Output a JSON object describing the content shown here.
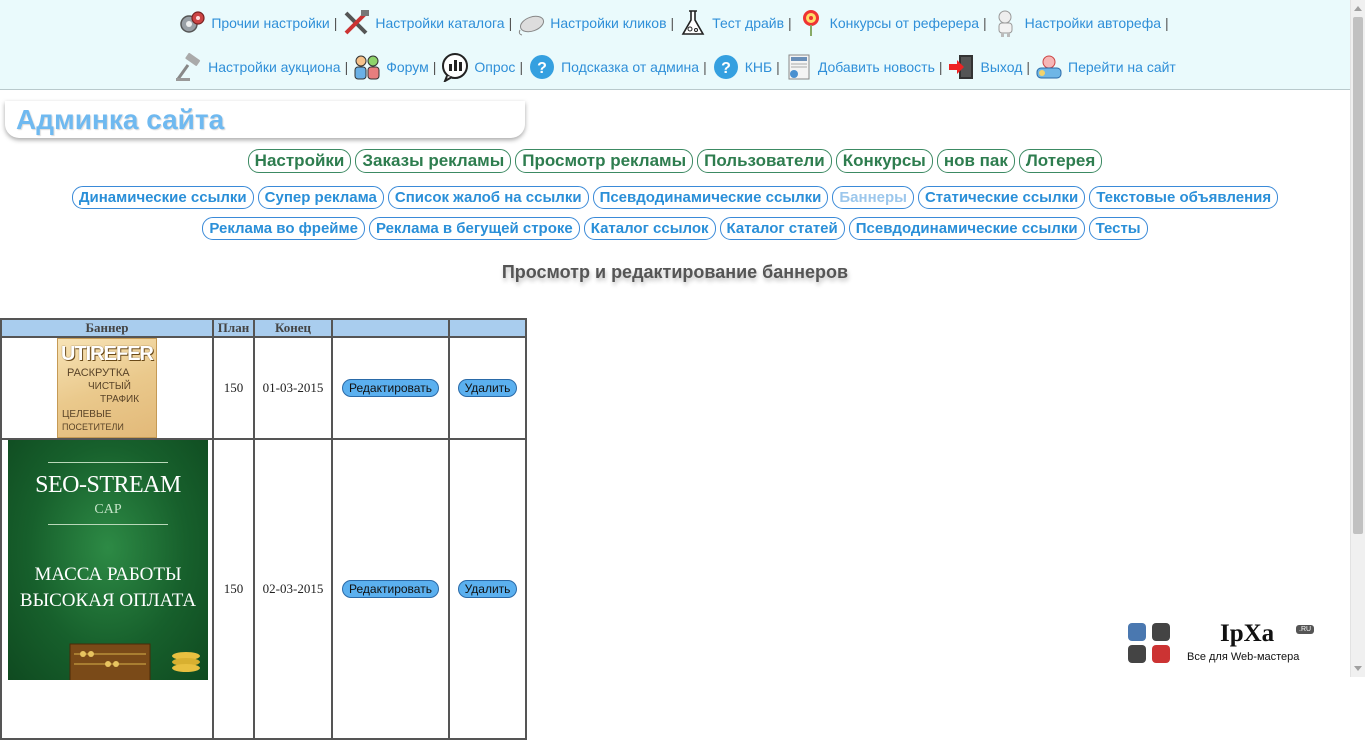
{
  "nav": {
    "row1": [
      {
        "label": "Прочии настройки",
        "icon": "gears-icon"
      },
      {
        "label": "Настройки каталога",
        "icon": "tools-icon"
      },
      {
        "label": "Настройки кликов",
        "icon": "mouse-icon"
      },
      {
        "label": "Тест драйв",
        "icon": "flask-icon"
      },
      {
        "label": "Конкурсы от реферера",
        "icon": "target-icon"
      },
      {
        "label": "Настройки авторефа",
        "icon": "robot-icon"
      }
    ],
    "row2": [
      {
        "label": "Настройки аукциона",
        "icon": "gavel-icon"
      },
      {
        "label": "Форум",
        "icon": "people-icon"
      },
      {
        "label": "Опрос",
        "icon": "poll-icon"
      },
      {
        "label": "Подсказка от админа",
        "icon": "help-icon"
      },
      {
        "label": "КНБ",
        "icon": "help-icon"
      },
      {
        "label": "Добавить новость",
        "icon": "news-icon"
      },
      {
        "label": "Выход",
        "icon": "exit-icon"
      },
      {
        "label": "Перейти на сайт",
        "icon": "site-icon"
      }
    ],
    "separator": "|"
  },
  "admin_title": "Админка сайта",
  "main_menu": [
    "Настройки",
    "Заказы рекламы",
    "Просмотр рекламы",
    "Пользователи",
    "Конкурсы",
    "нов пак",
    "Лотерея"
  ],
  "sub_menu_1": [
    "Динамические ссылки",
    "Супер реклама",
    "Список жалоб на ссылки",
    "Псевдодинамические ссылки",
    "Баннеры",
    "Статические ссылки",
    "Текстовые объявления"
  ],
  "sub_menu_2": [
    "Реклама во фрейме",
    "Реклама в бегущей строке",
    "Каталог ссылок",
    "Каталог статей",
    "Псевдодинамические ссылки",
    "Тесты"
  ],
  "active_sub": "Баннеры",
  "page_heading": "Просмотр и редактирование баннеров",
  "table": {
    "headers": [
      "Баннер",
      "План",
      "Конец",
      "",
      ""
    ],
    "rows": [
      {
        "plan": "150",
        "end": "01-03-2015",
        "edit": "Редактировать",
        "delete": "Удалить",
        "banner": {
          "logo": "UTIREFER",
          "lines": [
            "РАСКРУТКА",
            "ЧИСТЫЙ",
            "ТРАФИК",
            "ЦЕЛЕВЫЕ",
            "ПОСЕТИТЕЛИ"
          ]
        }
      },
      {
        "plan": "150",
        "end": "02-03-2015",
        "edit": "Редактировать",
        "delete": "Удалить",
        "banner": {
          "title": "SEO-STREAM",
          "subtitle": "CAP",
          "line1": "МАССА РАБОТЫ",
          "line2": "ВЫСОКАЯ ОПЛАТА"
        }
      }
    ]
  },
  "watermark": {
    "brand": "IpXa",
    "badge": ".RU",
    "tagline": "Все для Web-мастера"
  },
  "colors": {
    "nav_bg": "#eafafc",
    "link": "#2f8fd8",
    "main_menu_text": "#2e7d4f",
    "table_header": "#a9cdee",
    "button": "#5bb0ef"
  }
}
